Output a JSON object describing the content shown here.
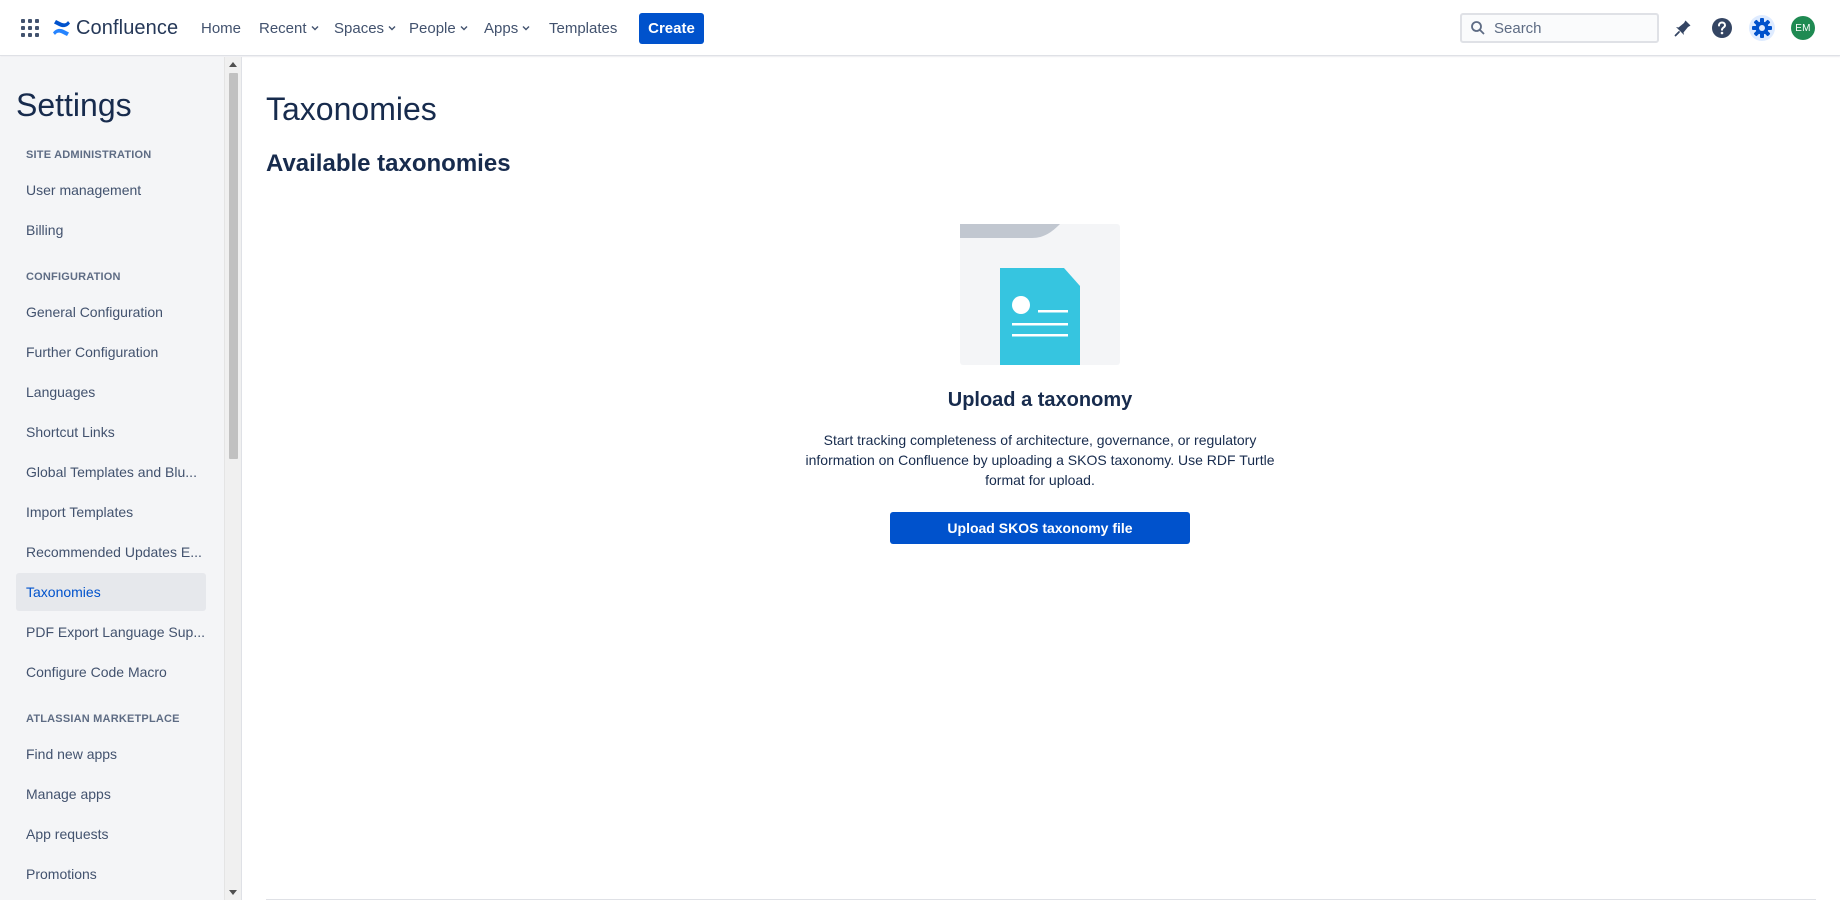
{
  "topnav": {
    "app_name": "Confluence",
    "items": [
      {
        "label": "Home",
        "has_dropdown": false
      },
      {
        "label": "Recent",
        "has_dropdown": true
      },
      {
        "label": "Spaces",
        "has_dropdown": true
      },
      {
        "label": "People",
        "has_dropdown": true
      },
      {
        "label": "Apps",
        "has_dropdown": true
      },
      {
        "label": "Templates",
        "has_dropdown": false
      }
    ],
    "create_label": "Create",
    "search_placeholder": "Search",
    "avatar_initials": "EM",
    "icons": [
      "app-switcher-icon",
      "confluence-logo-icon",
      "notifications-icon",
      "help-icon",
      "settings-icon"
    ]
  },
  "sidebar": {
    "title": "Settings",
    "sections": [
      {
        "heading": "SITE ADMINISTRATION",
        "items": [
          "User management",
          "Billing"
        ]
      },
      {
        "heading": "CONFIGURATION",
        "items": [
          "General Configuration",
          "Further Configuration",
          "Languages",
          "Shortcut Links",
          "Global Templates and Blu...",
          "Import Templates",
          "Recommended Updates E...",
          "Taxonomies",
          "PDF Export Language Sup...",
          "Configure Code Macro"
        ]
      },
      {
        "heading": "ATLASSIAN MARKETPLACE",
        "items": [
          "Find new apps",
          "Manage apps",
          "App requests",
          "Promotions"
        ]
      }
    ],
    "active_item": "Taxonomies"
  },
  "main": {
    "title": "Taxonomies",
    "subtitle": "Available taxonomies",
    "empty_state": {
      "title": "Upload a taxonomy",
      "description": "Start tracking completeness of architecture, governance, or regulatory information on Confluence by uploading a SKOS taxonomy. Use RDF Turtle format for upload.",
      "button_label": "Upload SKOS taxonomy file"
    }
  },
  "colors": {
    "brand": "#0052cc",
    "text": "#172b4d",
    "sidebar_bg": "#f4f5f7",
    "illustration_doc": "#36c5e0",
    "avatar_bg": "#1f8a52"
  }
}
